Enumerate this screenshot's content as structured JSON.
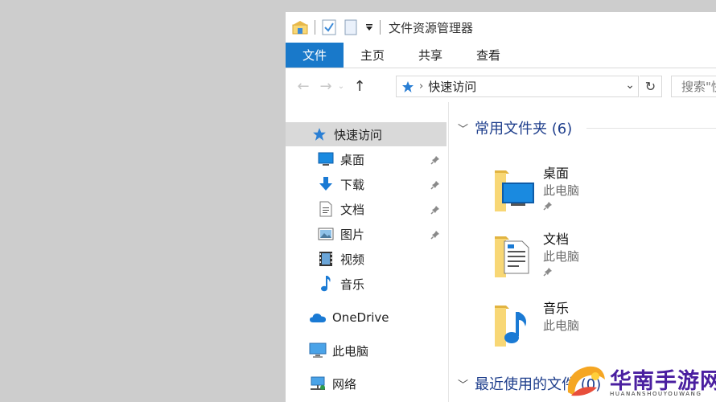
{
  "window": {
    "title": "文件资源管理器"
  },
  "ribbon": {
    "tabs": [
      {
        "label": "文件",
        "active": true
      },
      {
        "label": "主页",
        "active": false
      },
      {
        "label": "共享",
        "active": false
      },
      {
        "label": "查看",
        "active": false
      }
    ]
  },
  "address": {
    "path": "快速访问",
    "search_placeholder": "搜索\"快"
  },
  "navpane": {
    "items": [
      {
        "label": "快速访问",
        "icon": "star-icon",
        "selected": true
      },
      {
        "label": "桌面",
        "icon": "desktop-icon",
        "pinned": true
      },
      {
        "label": "下载",
        "icon": "download-icon",
        "pinned": true
      },
      {
        "label": "文档",
        "icon": "document-icon",
        "pinned": true
      },
      {
        "label": "图片",
        "icon": "picture-icon",
        "pinned": true
      },
      {
        "label": "视频",
        "icon": "video-icon"
      },
      {
        "label": "音乐",
        "icon": "music-icon"
      },
      {
        "label": "OneDrive",
        "icon": "cloud-icon"
      },
      {
        "label": "此电脑",
        "icon": "computer-icon"
      },
      {
        "label": "网络",
        "icon": "network-icon"
      }
    ]
  },
  "content": {
    "frequent_header": "常用文件夹 (6)",
    "recent_header": "最近使用的文件 (0)",
    "folders": [
      {
        "name": "桌面",
        "location": "此电脑",
        "pinned": true
      },
      {
        "name": "文档",
        "location": "此电脑",
        "pinned": true
      },
      {
        "name": "音乐",
        "location": "此电脑",
        "pinned": false
      }
    ]
  },
  "watermark": {
    "text": "华南手游网",
    "sub": "HUANANSHOUYOUWANG"
  },
  "colors": {
    "accent": "#1979ca",
    "group_header": "#1e3e8c",
    "folder": "#f8d775",
    "selection": "#d9d9d9"
  }
}
